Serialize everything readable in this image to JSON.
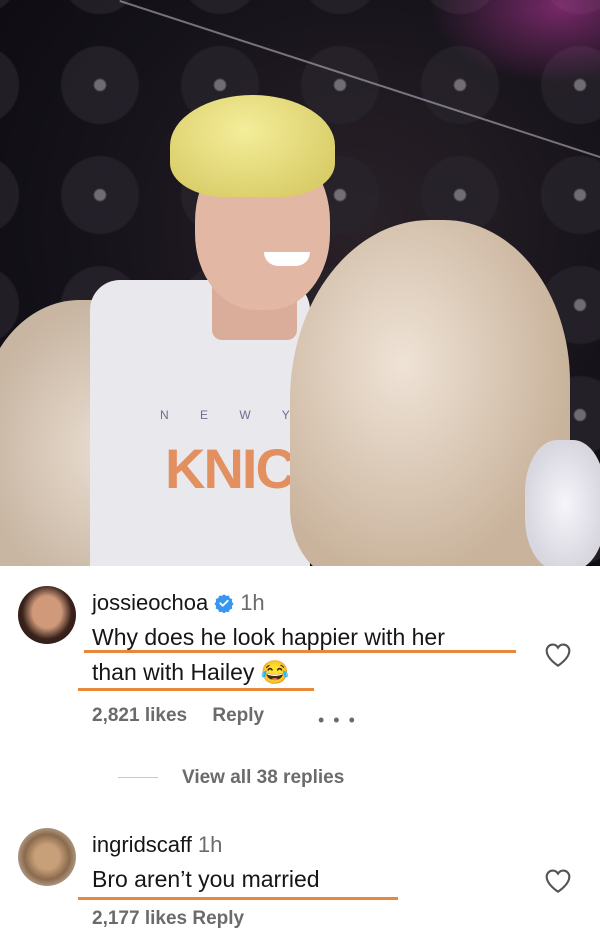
{
  "photo": {
    "shirt_top_text": "N E W Y O",
    "shirt_logo_text": "KNIC"
  },
  "comments": [
    {
      "username": "jossieochoa",
      "verified": true,
      "time": "1h",
      "lines": [
        "Why does he look happier with her",
        "than with Hailey 😂"
      ],
      "likes": "2,821 likes",
      "reply_label": "Reply",
      "more_icon": "more-dots-icon",
      "view_replies": "View all 38 replies",
      "like_icon": "heart-outline-icon"
    },
    {
      "username": "ingridscaff",
      "verified": false,
      "time": "1h",
      "lines": [
        "Bro aren’t you married"
      ],
      "like_icon": "heart-outline-icon",
      "likes_partial": "2,177 likes   Reply"
    }
  ],
  "colors": {
    "underline": "#e8883b",
    "verified_badge": "#3797f0",
    "muted_text": "#6b6b6b"
  }
}
